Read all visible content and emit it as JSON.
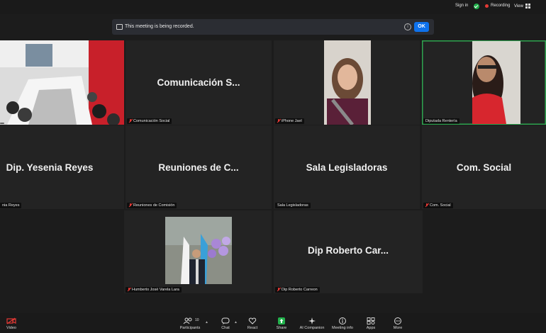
{
  "topbar": {
    "sign_in": "Sign in",
    "recording": "Recording",
    "view": "View"
  },
  "banner": {
    "text": "This meeting is being recorded.",
    "ok": "OK"
  },
  "tiles": [
    {
      "label": "",
      "display_name": ""
    },
    {
      "label": "Comunicación Social",
      "display_name": "Comunicación S..."
    },
    {
      "label": "iPhone Jael",
      "display_name": ""
    },
    {
      "label": "Diputada Rentería",
      "display_name": ""
    },
    {
      "label": "nia Reyes",
      "display_name": "Dip. Yesenia Reyes"
    },
    {
      "label": "Reuniones de Comisión",
      "display_name": "Reuniones de C..."
    },
    {
      "label": "Sala Legisladoras",
      "display_name": "Sala Legisladoras"
    },
    {
      "label": "Com. Social",
      "display_name": "Com. Social"
    },
    {
      "label": "Humberto José Varela Lara",
      "display_name": ""
    },
    {
      "label": "Dip Roberto Carreon",
      "display_name": "Dip Roberto Car..."
    }
  ],
  "toolbar": {
    "video": "Video",
    "participants": "Participants",
    "participants_count": "10",
    "chat": "Chat",
    "react": "React",
    "share": "Share",
    "ai_companion": "AI Companion",
    "meeting_info": "Meeting info",
    "apps": "Apps",
    "more": "More"
  },
  "colors": {
    "accent_blue": "#0e72ed",
    "active_speaker": "#2ea44f",
    "share_green": "#22b14c",
    "muted_red": "#e53935"
  }
}
